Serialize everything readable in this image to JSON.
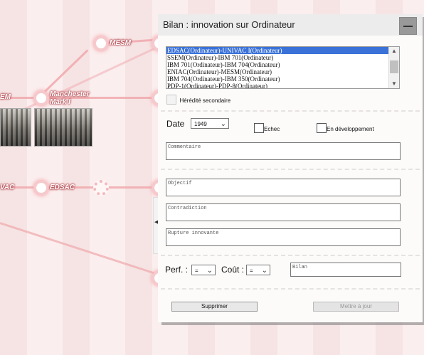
{
  "graph": {
    "nodes": [
      {
        "label": "MESM"
      },
      {
        "label": "EM"
      },
      {
        "label": "Manchester Mark I"
      },
      {
        "label": "VAC"
      },
      {
        "label": "EDSAC"
      }
    ]
  },
  "dialog": {
    "title": "Bilan : innovation sur Ordinateur",
    "list": {
      "items": [
        "EDSAC(Ordinateur)-UNIVAC I(Ordinateur)",
        "SSEM(Ordinateur)-IBM 701(Ordinateur)",
        "IBM 701(Ordinateur)-IBM 704(Ordinateur)",
        "ENIAC(Ordinateur)-MESM(Ordinateur)",
        "IBM 704(Ordinateur)-IBM 350(Ordinateur)",
        "PDP-1(Ordinateur)-PDP-8(Ordinateur)"
      ],
      "selected_index": 0
    },
    "heredite_label": "Hérédité secondaire",
    "date_label": "Date",
    "date_value": "1949",
    "echec_label": "Echec",
    "en_dev_label": "En développement",
    "commentaire_ph": "Commentaire",
    "objectif_ph": "Objectif",
    "contradiction_ph": "Contradiction",
    "rupture_ph": "Rupture innovante",
    "perf_label": "Perf. :",
    "perf_value": "=",
    "cout_label": "Coût :",
    "cout_value": "=",
    "bilan_ph": "Bilan",
    "supprimer_label": "Supprimer",
    "mettre_label": "Mettre à jour"
  },
  "side_tab_glyph": "◀",
  "colors": {
    "background": "#fbeeee",
    "link": "#f0a8ad",
    "selection": "#3a72d8"
  }
}
